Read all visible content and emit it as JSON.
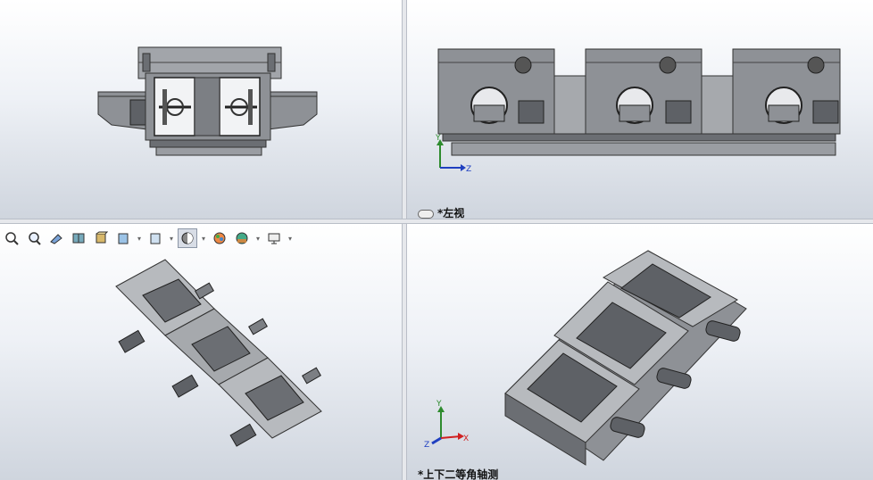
{
  "viewports": {
    "top_left": {
      "label": ""
    },
    "top_right": {
      "label": "*左视",
      "axes": {
        "y": "Y",
        "z": "Z"
      }
    },
    "bottom_left": {
      "label": ""
    },
    "bottom_right": {
      "label": "*上下二等角轴测",
      "axes": {
        "y": "Y",
        "x": "X",
        "z": "Z"
      }
    }
  },
  "toolbar": {
    "icons": [
      "zoom-to-fit-icon",
      "zoom-area-icon",
      "previous-view-icon",
      "section-view-icon",
      "view-orientation-icon",
      "display-style-icon",
      "hide-show-items-icon",
      "edit-appearance-icon",
      "apply-scene-icon",
      "view-settings-icon"
    ]
  },
  "colors": {
    "steel": "#8e9196",
    "steel_dark": "#5e6166",
    "steel_light": "#c4c6ca",
    "axis_y": "#2e8b2e",
    "axis_x": "#d02020",
    "axis_z": "#2040c0"
  }
}
